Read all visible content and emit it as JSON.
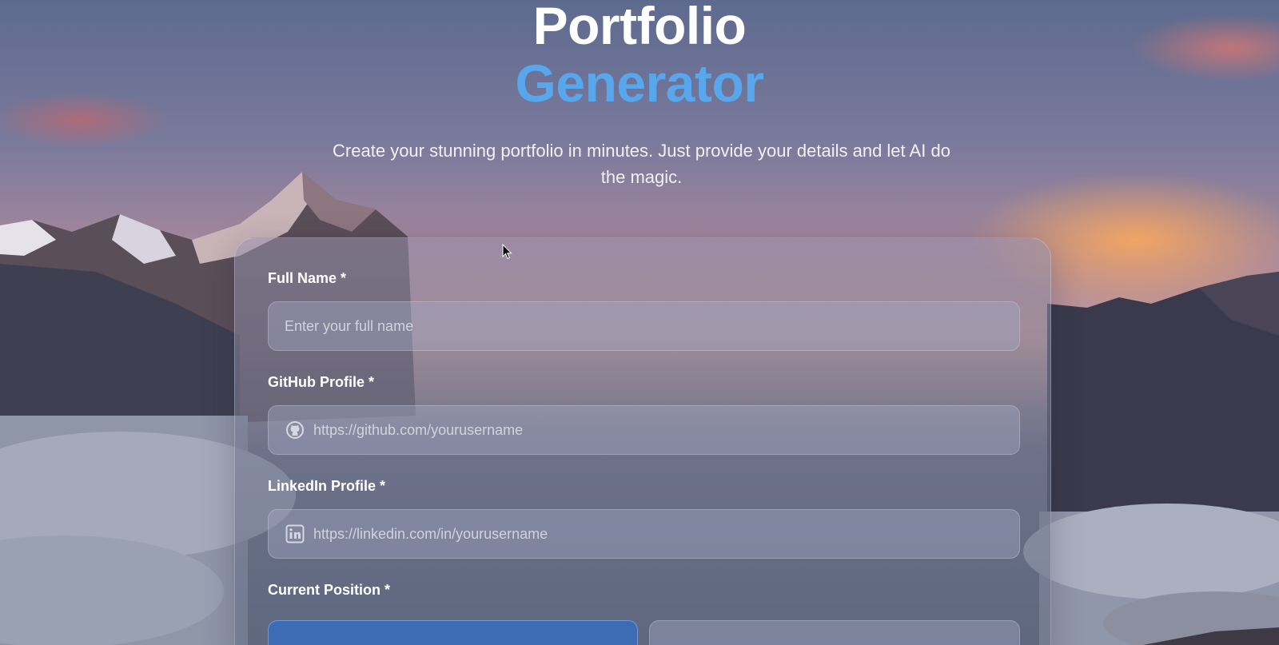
{
  "header": {
    "title_line1": "Portfolio",
    "title_line2": "Generator",
    "subtitle": "Create your stunning portfolio in minutes. Just provide your details and let AI do the magic."
  },
  "form": {
    "full_name": {
      "label": "Full Name *",
      "placeholder": "Enter your full name",
      "value": ""
    },
    "github": {
      "label": "GitHub Profile *",
      "placeholder": "https://github.com/yourusername",
      "value": "",
      "icon": "github-icon"
    },
    "linkedin": {
      "label": "LinkedIn Profile *",
      "placeholder": "https://linkedin.com/in/yourusername",
      "value": "",
      "icon": "linkedin-icon"
    },
    "current_position": {
      "label": "Current Position *"
    }
  },
  "colors": {
    "accent": "#58a7ec",
    "selected_option": "#3e6cb4"
  }
}
